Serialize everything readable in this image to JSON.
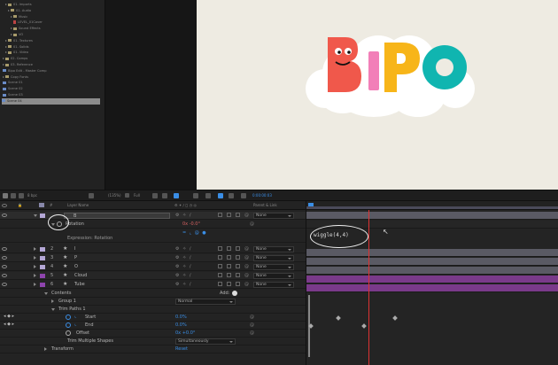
{
  "project_panel": {
    "items": [
      {
        "label": "01. Imports",
        "kind": "folder",
        "indent": 2
      },
      {
        "label": "01. Audio",
        "kind": "folder",
        "indent": 3
      },
      {
        "label": "Music",
        "kind": "folder",
        "indent": 4
      },
      {
        "label": "LEVEL_01Cover",
        "kind": "file",
        "indent": 5
      },
      {
        "label": "Sound Effects",
        "kind": "folder",
        "indent": 4
      },
      {
        "label": "VO",
        "kind": "folder",
        "indent": 4
      },
      {
        "label": "01. Textures",
        "kind": "folder",
        "indent": 2
      },
      {
        "label": "01. Solids",
        "kind": "folder",
        "indent": 2
      },
      {
        "label": "01. Video",
        "kind": "folder",
        "indent": 2
      },
      {
        "label": "02. Comps",
        "kind": "folder",
        "indent": 1
      },
      {
        "label": "03. Reference",
        "kind": "folder",
        "indent": 1
      },
      {
        "label": "Bipo Edit - Master Comp",
        "kind": "comp",
        "indent": 1
      },
      {
        "label": "Copy Fonts",
        "kind": "folder",
        "indent": 1
      },
      {
        "label": "Scene 01",
        "kind": "comp",
        "indent": 1
      },
      {
        "label": "Scene 02",
        "kind": "comp",
        "indent": 1
      },
      {
        "label": "Scene 03",
        "kind": "comp",
        "indent": 1
      },
      {
        "label": "Scene 04",
        "kind": "comp",
        "indent": 1,
        "selected": true
      }
    ]
  },
  "viewer": {
    "logo_letters": [
      "B",
      "I",
      "P",
      "O"
    ],
    "colors": {
      "bg": "#eeebe2",
      "cloud": "#ffffff",
      "b": "#f0584b",
      "i": "#f27fb8",
      "p": "#f7b519",
      "o": "#10b5b0"
    }
  },
  "viewer_strip": {
    "bpc": "8 bpc",
    "zoom": "(135%)",
    "resolution": "Full",
    "timecode": "0:00:00:03"
  },
  "timeline_header": {
    "col_hash": "#",
    "col_layer_name": "Layer Name",
    "col_parent": "Parent & Link"
  },
  "layers": {
    "row_b": {
      "number": "",
      "name": "B",
      "parent": "None"
    },
    "rotation": {
      "label": "Rotation",
      "value": "0x -0.0°"
    },
    "expression_label": "Expression: Rotation",
    "expression_code": "wiggle(4,4)",
    "rows": [
      {
        "number": "2",
        "name": "I",
        "parent": "None",
        "color": "#b4a7d6"
      },
      {
        "number": "3",
        "name": "P",
        "parent": "None",
        "color": "#b4a7d6"
      },
      {
        "number": "4",
        "name": "O",
        "parent": "None",
        "color": "#b4a7d6"
      },
      {
        "number": "5",
        "name": "Cloud",
        "parent": "None",
        "color": "#8e44ad"
      },
      {
        "number": "6",
        "name": "Tube",
        "parent": "None",
        "color": "#8e44ad"
      }
    ],
    "contents": {
      "label": "Contents",
      "add_label": "Add:"
    },
    "group1": {
      "label": "Group 1",
      "mode": "Normal"
    },
    "trim_paths": {
      "label": "Trim Paths 1"
    },
    "start": {
      "label": "Start",
      "value": "0.0%"
    },
    "end": {
      "label": "End",
      "value": "0.0%"
    },
    "offset": {
      "label": "Offset",
      "value": "0x +0.0°"
    },
    "trim_multiple": {
      "label": "Trim Multiple Shapes",
      "value": "Simultaneously"
    },
    "transform": {
      "label": "Transform",
      "value": "Reset"
    }
  }
}
